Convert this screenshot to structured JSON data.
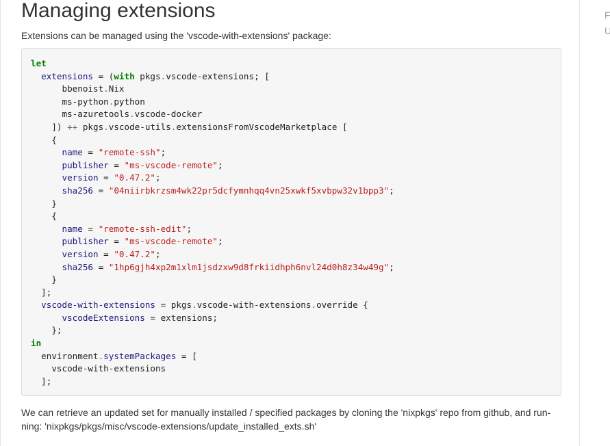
{
  "heading": "Managing extensions",
  "intro": "Extensions can be managed using the 'vscode-with-extensions' package:",
  "side_letters": [
    "F",
    "U"
  ],
  "code": {
    "language": "nix",
    "lines": [
      [
        {
          "t": "let",
          "c": "kw"
        }
      ],
      [
        {
          "t": "  "
        },
        {
          "t": "extensions",
          "c": "var"
        },
        {
          "t": " = ("
        },
        {
          "t": "with",
          "c": "kw"
        },
        {
          "t": " pkgs"
        },
        {
          "t": ".",
          "c": "op"
        },
        {
          "t": "vscode-extensions; ["
        }
      ],
      [
        {
          "t": "      bbenoist"
        },
        {
          "t": ".",
          "c": "op"
        },
        {
          "t": "Nix"
        }
      ],
      [
        {
          "t": "      ms-python"
        },
        {
          "t": ".",
          "c": "op"
        },
        {
          "t": "python"
        }
      ],
      [
        {
          "t": "      ms-azuretools"
        },
        {
          "t": ".",
          "c": "op"
        },
        {
          "t": "vscode-docker"
        }
      ],
      [
        {
          "t": "    ]) "
        },
        {
          "t": "++",
          "c": "op"
        },
        {
          "t": " pkgs"
        },
        {
          "t": ".",
          "c": "op"
        },
        {
          "t": "vscode-utils"
        },
        {
          "t": ".",
          "c": "op"
        },
        {
          "t": "extensionsFromVscodeMarketplace ["
        }
      ],
      [
        {
          "t": "    {"
        }
      ],
      [
        {
          "t": "      "
        },
        {
          "t": "name",
          "c": "var"
        },
        {
          "t": " = "
        },
        {
          "t": "\"remote-ssh\"",
          "c": "str"
        },
        {
          "t": ";"
        }
      ],
      [
        {
          "t": "      "
        },
        {
          "t": "publisher",
          "c": "var"
        },
        {
          "t": " = "
        },
        {
          "t": "\"ms-vscode-remote\"",
          "c": "str"
        },
        {
          "t": ";"
        }
      ],
      [
        {
          "t": "      "
        },
        {
          "t": "version",
          "c": "var"
        },
        {
          "t": " = "
        },
        {
          "t": "\"0.47.2\"",
          "c": "str"
        },
        {
          "t": ";"
        }
      ],
      [
        {
          "t": "      "
        },
        {
          "t": "sha256",
          "c": "var"
        },
        {
          "t": " = "
        },
        {
          "t": "\"04niirbkrzsm4wk22pr5dcfymnhqq4vn25xwkf5xvbpw32v1bpp3\"",
          "c": "str"
        },
        {
          "t": ";"
        }
      ],
      [
        {
          "t": "    }"
        }
      ],
      [
        {
          "t": "    {"
        }
      ],
      [
        {
          "t": "      "
        },
        {
          "t": "name",
          "c": "var"
        },
        {
          "t": " = "
        },
        {
          "t": "\"remote-ssh-edit\"",
          "c": "str"
        },
        {
          "t": ";"
        }
      ],
      [
        {
          "t": "      "
        },
        {
          "t": "publisher",
          "c": "var"
        },
        {
          "t": " = "
        },
        {
          "t": "\"ms-vscode-remote\"",
          "c": "str"
        },
        {
          "t": ";"
        }
      ],
      [
        {
          "t": "      "
        },
        {
          "t": "version",
          "c": "var"
        },
        {
          "t": " = "
        },
        {
          "t": "\"0.47.2\"",
          "c": "str"
        },
        {
          "t": ";"
        }
      ],
      [
        {
          "t": "      "
        },
        {
          "t": "sha256",
          "c": "var"
        },
        {
          "t": " = "
        },
        {
          "t": "\"1hp6gjh4xp2m1xlm1jsdzxw9d8frkiidhph6nvl24d0h8z34w49g\"",
          "c": "str"
        },
        {
          "t": ";"
        }
      ],
      [
        {
          "t": "    }"
        }
      ],
      [
        {
          "t": "  ];"
        }
      ],
      [
        {
          "t": "  "
        },
        {
          "t": "vscode-with-extensions",
          "c": "var"
        },
        {
          "t": " = pkgs"
        },
        {
          "t": ".",
          "c": "op"
        },
        {
          "t": "vscode-with-extensions"
        },
        {
          "t": ".",
          "c": "op"
        },
        {
          "t": "override {"
        }
      ],
      [
        {
          "t": "      "
        },
        {
          "t": "vscodeExtensions",
          "c": "var"
        },
        {
          "t": " = extensions;"
        }
      ],
      [
        {
          "t": "    };"
        }
      ],
      [
        {
          "t": "in",
          "c": "kw"
        }
      ],
      [
        {
          "t": "  environment"
        },
        {
          "t": ".",
          "c": "op"
        },
        {
          "t": "systemPackages",
          "c": "var"
        },
        {
          "t": " = ["
        }
      ],
      [
        {
          "t": "    vscode-with-extensions"
        }
      ],
      [
        {
          "t": "  ];"
        }
      ]
    ]
  },
  "outro": {
    "line1": "We can retrieve an updated set for manually installed / specified packages by cloning the 'nixpkgs' repo from github, and run-",
    "line2": "ning: 'nixpkgs/pkgs/misc/vscode-extensions/update_installed_exts.sh'"
  },
  "colors": {
    "keyword": "#008000",
    "attribute": "#19177c",
    "string": "#ba2121",
    "operator": "#666666",
    "code_background": "#f6f6f6"
  }
}
